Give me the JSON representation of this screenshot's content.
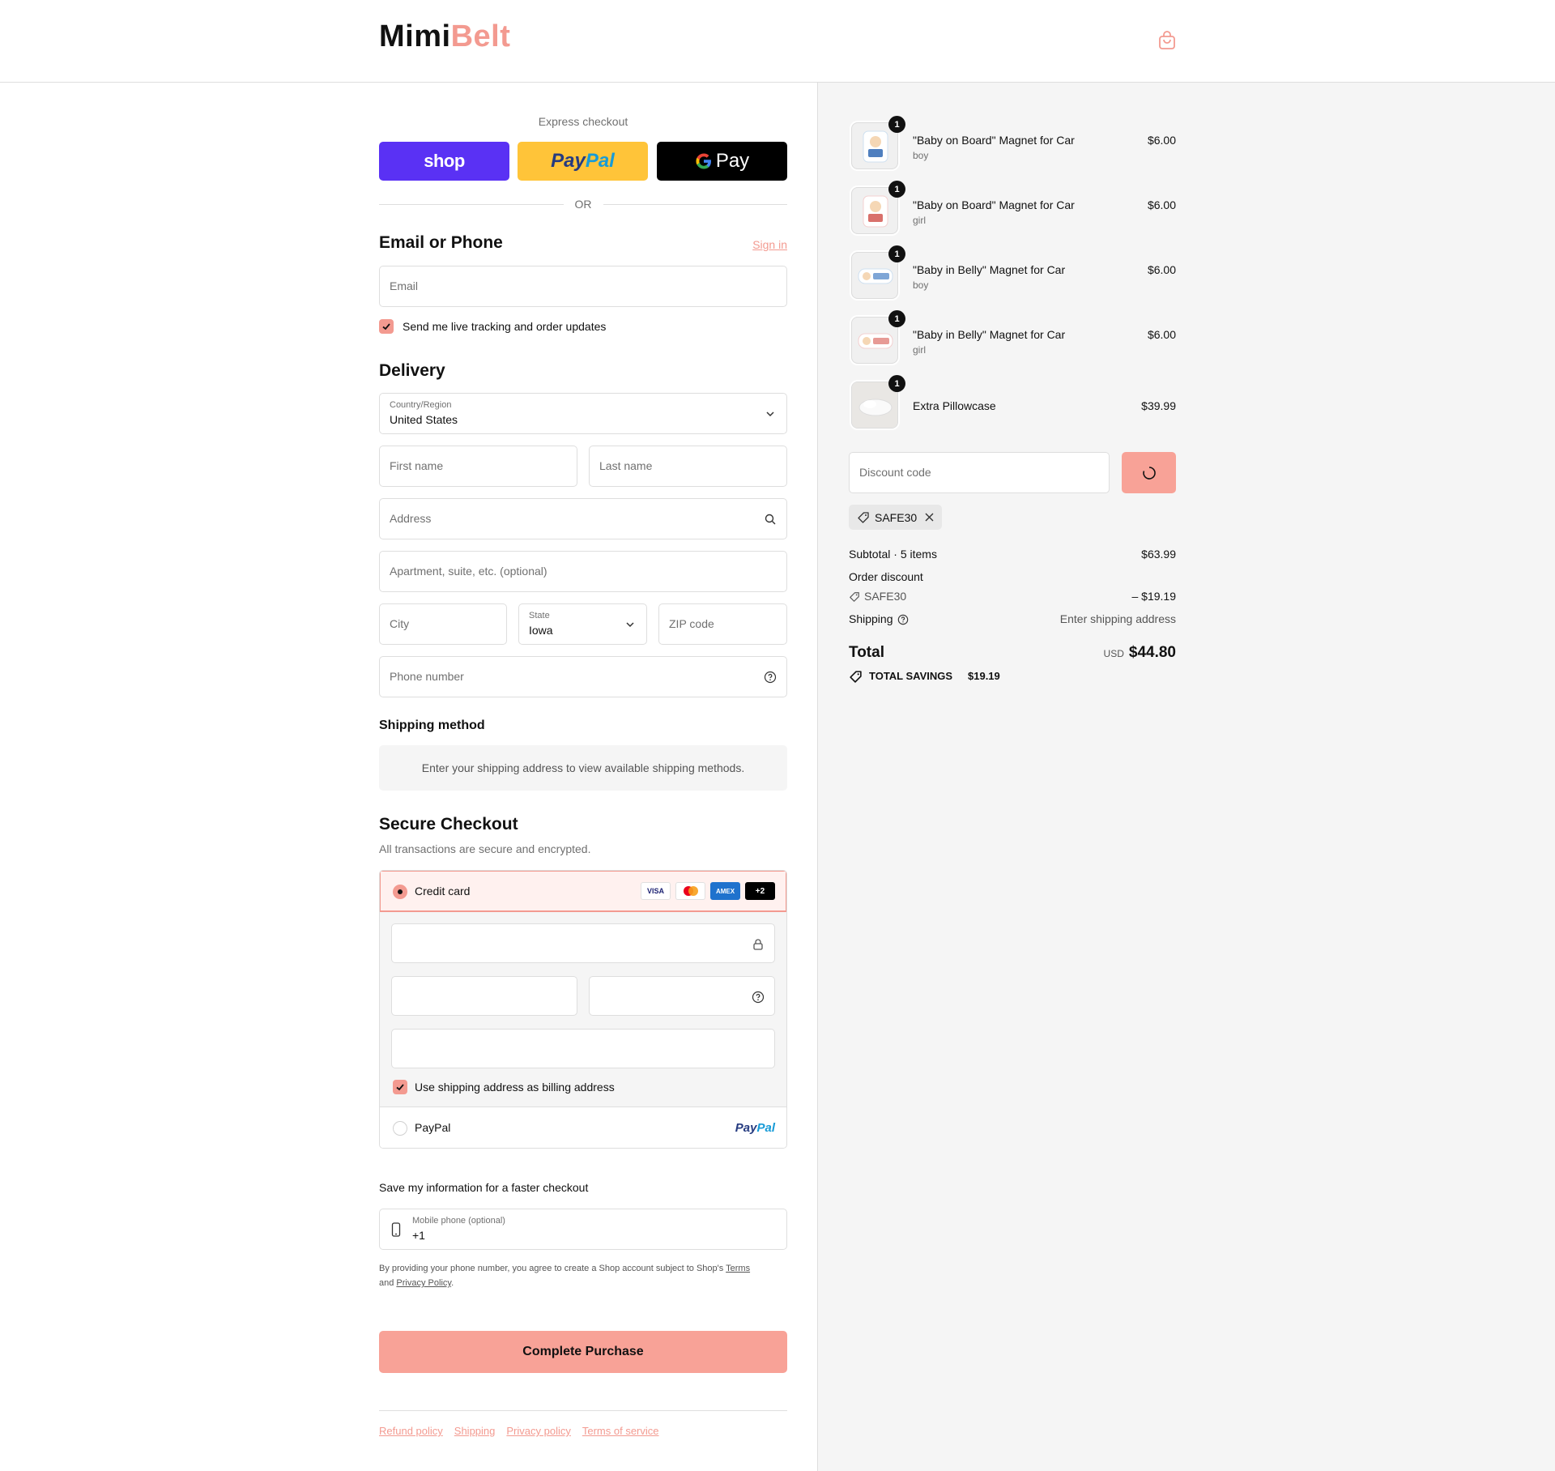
{
  "brand": {
    "part1": "Mimi",
    "part2": "Belt",
    "accent": "#f39a90"
  },
  "express": {
    "title": "Express checkout",
    "shop_label": "shop",
    "paypal_a": "Pay",
    "paypal_b": "Pal",
    "gpay_label": "Pay",
    "or": "OR"
  },
  "contact": {
    "heading": "Email or Phone",
    "sign_in": "Sign in",
    "email_placeholder": "Email",
    "updates_label": "Send me live tracking and order updates"
  },
  "delivery": {
    "heading": "Delivery",
    "country_label": "Country/Region",
    "country_value": "United States",
    "first_name": "First name",
    "last_name": "Last name",
    "address": "Address",
    "apartment": "Apartment, suite, etc. (optional)",
    "city": "City",
    "state_label": "State",
    "state_value": "Iowa",
    "zip": "ZIP code",
    "phone": "Phone number"
  },
  "shipping_method": {
    "heading": "Shipping method",
    "message": "Enter your shipping address to view available shipping methods."
  },
  "payment": {
    "heading": "Secure Checkout",
    "subheading": "All transactions are secure and encrypted.",
    "credit_card": "Credit card",
    "cards": [
      "VISA",
      "AMEX",
      "+2"
    ],
    "billing_label": "Use shipping address as billing address",
    "paypal": "PayPal",
    "paypal_logo_a": "Pay",
    "paypal_logo_b": "Pal"
  },
  "save_info": {
    "title": "Save my information for a faster checkout",
    "mobile_label": "Mobile phone (optional)",
    "mobile_value": "+1",
    "terms_1": "By providing your phone number, you agree to create a Shop account subject to Shop's",
    "terms_link": "Terms",
    "terms_2": "and",
    "privacy_link": "Privacy Policy",
    "terms_3": "."
  },
  "cta": "Complete Purchase",
  "footer_links": [
    "Refund policy",
    "Shipping",
    "Privacy policy",
    "Terms of service"
  ],
  "cart": {
    "items": [
      {
        "name": "\"Baby on Board\" Magnet for Car",
        "variant": "boy",
        "price": "$6.00",
        "qty": "1"
      },
      {
        "name": "\"Baby on Board\" Magnet for Car",
        "variant": "girl",
        "price": "$6.00",
        "qty": "1"
      },
      {
        "name": "\"Baby in Belly\" Magnet for Car",
        "variant": "boy",
        "price": "$6.00",
        "qty": "1"
      },
      {
        "name": "\"Baby in Belly\" Magnet for Car",
        "variant": "girl",
        "price": "$6.00",
        "qty": "1"
      },
      {
        "name": "Extra Pillowcase",
        "variant": "",
        "price": "$39.99",
        "qty": "1"
      }
    ],
    "discount_placeholder": "Discount code",
    "applied_code": "SAFE30",
    "subtotal_label": "Subtotal · 5 items",
    "subtotal": "$63.99",
    "order_discount_label": "Order discount",
    "discount_code": "SAFE30",
    "discount_amount": "– $19.19",
    "shipping_label": "Shipping",
    "shipping_value": "Enter shipping address",
    "total_label": "Total",
    "currency": "USD",
    "total": "$44.80",
    "savings_label": "TOTAL SAVINGS",
    "savings": "$19.19"
  }
}
